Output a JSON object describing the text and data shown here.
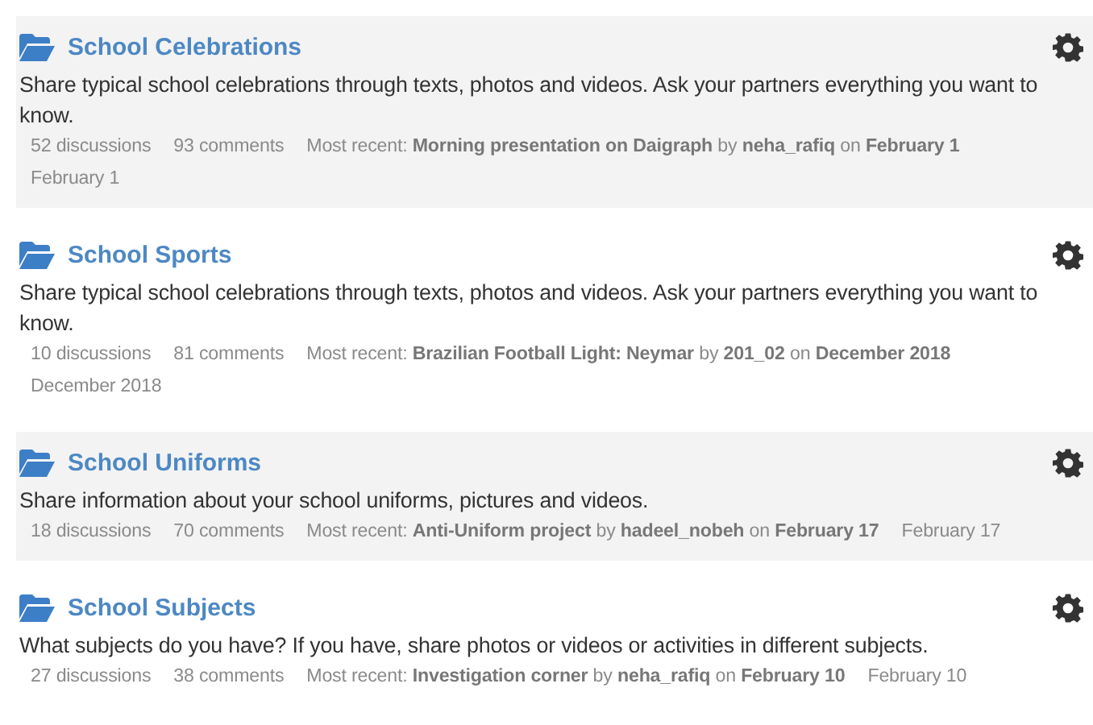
{
  "categories": [
    {
      "title": "School Celebrations",
      "description": "Share typical school celebrations through texts, photos and videos. Ask your partners everything you want to know.",
      "discussions": "52 discussions",
      "comments": "93 comments",
      "most_recent": "Most recent: **Morning presentation on Daigraph** by **neha_rafiq** on **February 1**",
      "date": "February 1"
    },
    {
      "title": "School Sports",
      "description": "Share typical school celebrations through texts, photos and videos. Ask your partners everything you want to know.",
      "discussions": "10 discussions",
      "comments": "81 comments",
      "most_recent": "Most recent: **Brazilian Football Light: Neymar** by **201_02** on **December 2018**",
      "date": "December 2018"
    },
    {
      "title": "School Uniforms",
      "description": "Share information about your school uniforms, pictures and videos.",
      "discussions": "18 discussions",
      "comments": "70 comments",
      "most_recent": "Most recent: **Anti-Uniform project** by **hadeel_nobeh** on **February 17**",
      "date": "February 17"
    },
    {
      "title": "School Subjects",
      "description": "What subjects do you have? If you have, share photos or videos or activities in different subjects.",
      "discussions": "27 discussions",
      "comments": "38 comments",
      "most_recent": "Most recent: **Investigation corner** by **neha_rafiq** on **February 10**",
      "date": "February 10"
    }
  ]
}
